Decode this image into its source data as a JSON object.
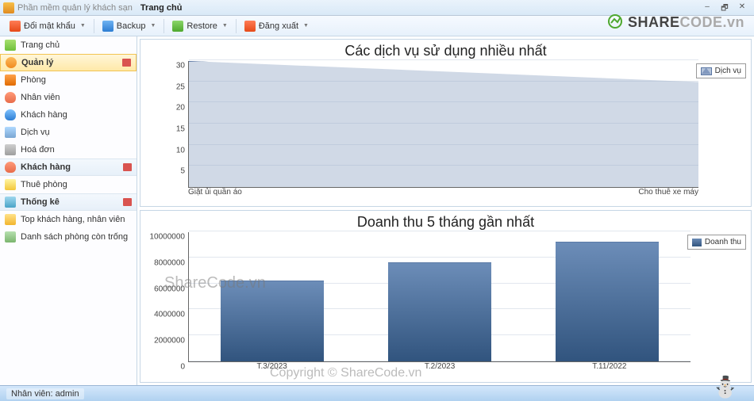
{
  "window": {
    "app_title": "Phần mềm quản lý khách sạn",
    "active_tab": "Trang chủ",
    "min": "–",
    "restore": "🗗",
    "close": "✕"
  },
  "toolbar": {
    "change_pw": "Đổi mật khẩu",
    "backup": "Backup",
    "restore": "Restore",
    "logout": "Đăng xuất"
  },
  "brand": {
    "left": "SHARE",
    "right": "CODE",
    "suffix": ".vn"
  },
  "sidebar": {
    "home": "Trang chủ",
    "manage": "Quản lý",
    "room": "Phòng",
    "employee": "Nhân viên",
    "customer": "Khách hàng",
    "service": "Dịch vụ",
    "invoice": "Hoá đơn",
    "customer_hdr": "Khách hàng",
    "rent": "Thuê phòng",
    "stats": "Thống kê",
    "top": "Top khách hàng, nhân viên",
    "empty_rooms": "Danh sách phòng còn trống"
  },
  "charts": {
    "top": {
      "title": "Các dịch vụ sử dụng nhiều nhất",
      "legend": "Dịch vụ",
      "x_left": "Giặt ủi quần áo",
      "x_right": "Cho thuê xe máy"
    },
    "bottom": {
      "title": "Doanh thu 5 tháng gần nhất",
      "legend": "Doanh thu",
      "x1": "T.3/2023",
      "x2": "T.2/2023",
      "x3": "T.11/2022"
    }
  },
  "chart_data": [
    {
      "type": "area",
      "title": "Các dịch vụ sử dụng nhiều nhất",
      "series": [
        {
          "name": "Dịch vụ",
          "values": [
            30,
            25
          ]
        }
      ],
      "categories": [
        "Giặt ủi quần áo",
        "Cho thuê xe máy"
      ],
      "ylim": [
        0,
        30
      ],
      "yticks": [
        5,
        10,
        15,
        20,
        25,
        30
      ],
      "ylabel": "",
      "xlabel": ""
    },
    {
      "type": "bar",
      "title": "Doanh thu 5 tháng gần nhất",
      "series": [
        {
          "name": "Doanh thu",
          "values": [
            6200000,
            7600000,
            9200000
          ]
        }
      ],
      "categories": [
        "T.3/2023",
        "T.2/2023",
        "T.11/2022"
      ],
      "ylim": [
        0,
        10000000
      ],
      "yticks": [
        0,
        2000000,
        4000000,
        6000000,
        8000000,
        10000000
      ],
      "ylabel": "",
      "xlabel": ""
    }
  ],
  "status": {
    "user_label": "Nhân viên: admin"
  },
  "watermarks": {
    "wm1": "ShareCode.vn",
    "wm2": "Copyright © ShareCode.vn"
  }
}
